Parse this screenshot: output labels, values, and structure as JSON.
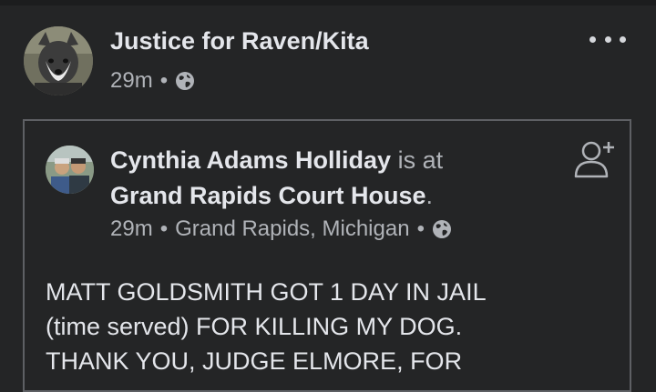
{
  "post": {
    "page_name": "Justice for Raven/Kita",
    "time": "29m",
    "separator": "•",
    "privacy_icon": "globe-icon",
    "more_icon": "more-options-icon"
  },
  "shared_post": {
    "author": "Cynthia Adams Holliday",
    "is_at": "is at",
    "place": "Grand Rapids Court House",
    "place_suffix": ".",
    "time": "29m",
    "location": "Grand Rapids, Michigan",
    "separator": "•",
    "privacy_icon": "globe-icon",
    "add_friend_icon": "add-friend-icon",
    "text": "MATT GOLDSMITH GOT 1 DAY IN JAIL\n(time served) FOR KILLING MY DOG.\nTHANK YOU, JUDGE ELMORE, FOR"
  },
  "colors": {
    "background": "#242526",
    "primary_text": "#e4e6eb",
    "secondary_text": "#b0b3b8",
    "card_border": "#5e6064"
  }
}
